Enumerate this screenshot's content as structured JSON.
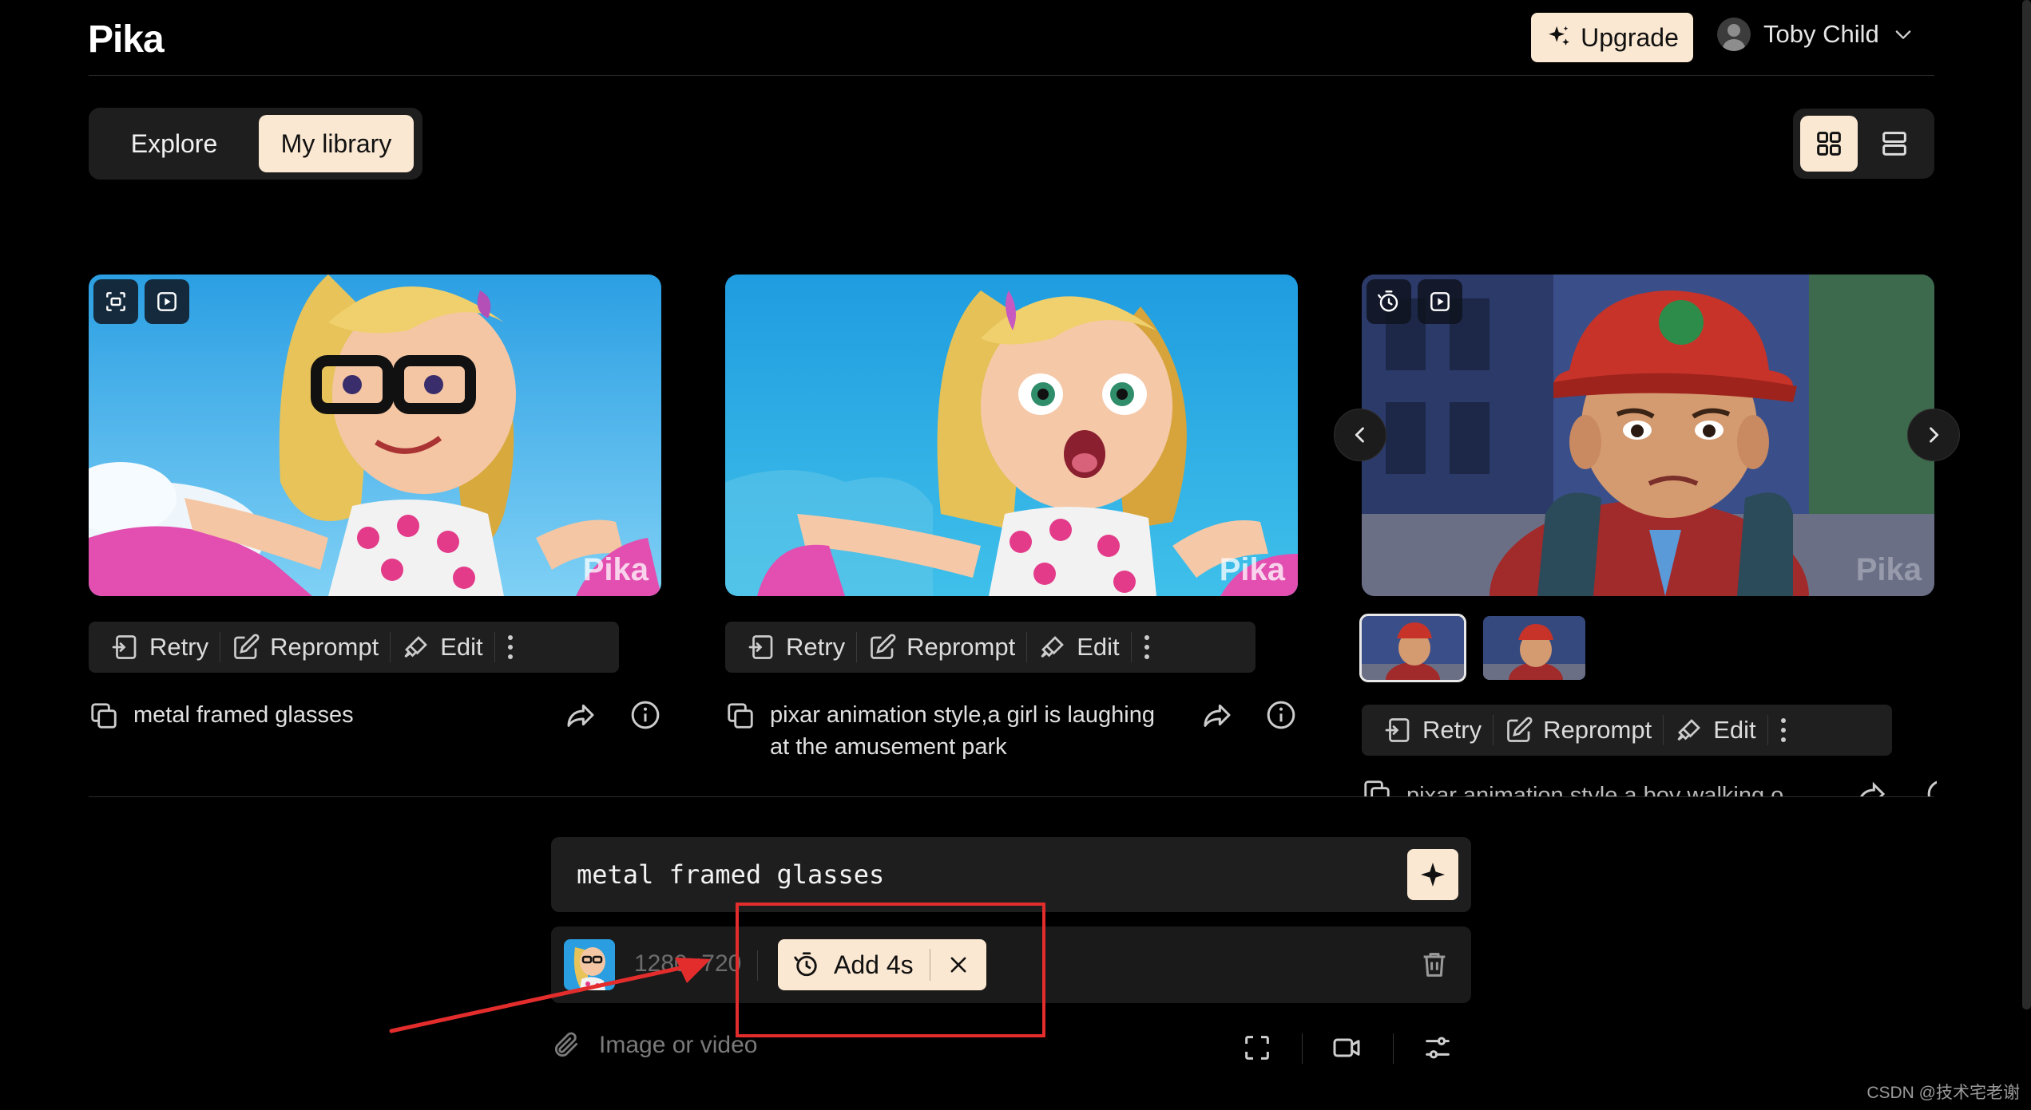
{
  "app": {
    "logo": "Pika"
  },
  "header": {
    "upgrade_label": "Upgrade",
    "user_name": "Toby Child"
  },
  "tabs": [
    {
      "label": "Explore",
      "active": false
    },
    {
      "label": "My library",
      "active": true
    }
  ],
  "view_toggle": {
    "active": "grid"
  },
  "cards": [
    {
      "watermark": "Pika",
      "actions": {
        "retry": "Retry",
        "reprompt": "Reprompt",
        "edit": "Edit"
      },
      "caption": "metal framed glasses"
    },
    {
      "watermark": "Pika",
      "actions": {
        "retry": "Retry",
        "reprompt": "Reprompt",
        "edit": "Edit"
      },
      "caption": "pixar animation style,a girl is laughing at the amusement park"
    },
    {
      "watermark": "Pika",
      "actions": {
        "retry": "Retry",
        "reprompt": "Reprompt",
        "edit": "Edit"
      },
      "caption": "pixar animation style,a boy walking o..."
    }
  ],
  "prompt": {
    "text": "metal framed glasses",
    "resolution": "1280×720",
    "chip_label": "Add 4s",
    "attach_placeholder": "Image or video"
  },
  "footer": {
    "watermark": "CSDN @技术宅老谢"
  },
  "colors": {
    "accent": "#fbe8d2",
    "background": "#000000",
    "panel": "#1e1e1e",
    "annotation": "#e32c2c"
  }
}
